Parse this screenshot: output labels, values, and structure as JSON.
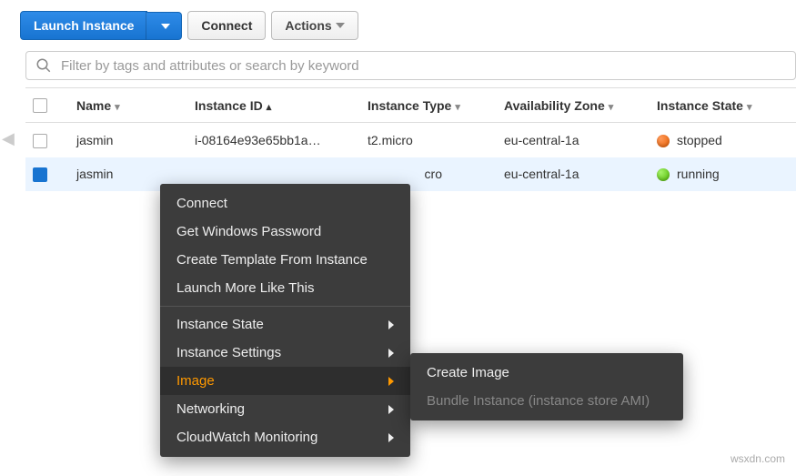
{
  "toolbar": {
    "launch_label": "Launch Instance",
    "connect_label": "Connect",
    "actions_label": "Actions"
  },
  "search": {
    "placeholder": "Filter by tags and attributes or search by keyword"
  },
  "columns": {
    "name": "Name",
    "instance_id": "Instance ID",
    "instance_type": "Instance Type",
    "availability_zone": "Availability Zone",
    "instance_state": "Instance State"
  },
  "rows": [
    {
      "name": "jasmin",
      "instance_id": "i-08164e93e65bb1a…",
      "instance_type": "t2.micro",
      "availability_zone": "eu-central-1a",
      "state": "stopped"
    },
    {
      "name": "jasmin",
      "instance_id": "",
      "instance_type": "cro",
      "availability_zone": "eu-central-1a",
      "state": "running"
    }
  ],
  "context_menu": {
    "connect": "Connect",
    "get_windows_password": "Get Windows Password",
    "create_template": "Create Template From Instance",
    "launch_more": "Launch More Like This",
    "instance_state": "Instance State",
    "instance_settings": "Instance Settings",
    "image": "Image",
    "networking": "Networking",
    "cloudwatch": "CloudWatch Monitoring"
  },
  "submenu": {
    "create_image": "Create Image",
    "bundle_instance": "Bundle Instance (instance store AMI)"
  },
  "watermark": "wsxdn.com"
}
